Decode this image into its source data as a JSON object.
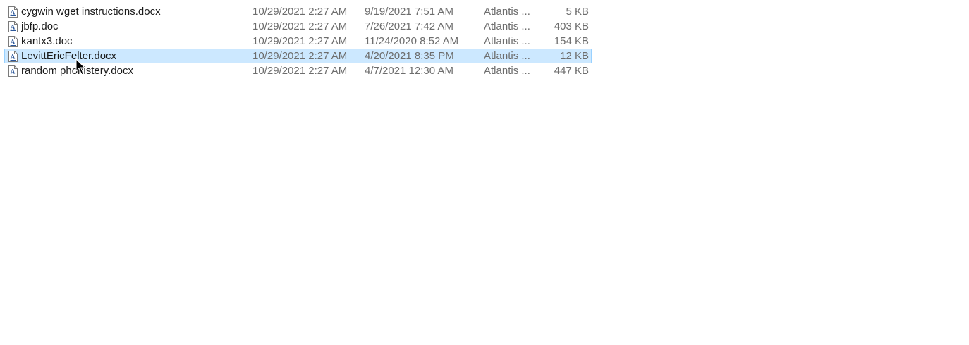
{
  "files": [
    {
      "name": "cygwin wget instructions.docx",
      "created": "10/29/2021 2:27 AM",
      "modified": "9/19/2021 7:51 AM",
      "author": "Atlantis ...",
      "size": "5 KB",
      "icon": "word-document-icon",
      "selected": false
    },
    {
      "name": "jbfp.doc",
      "created": "10/29/2021 2:27 AM",
      "modified": "7/26/2021 7:42 AM",
      "author": "Atlantis ...",
      "size": "403 KB",
      "icon": "word-document-icon",
      "selected": false
    },
    {
      "name": "kantx3.doc",
      "created": "10/29/2021 2:27 AM",
      "modified": "11/24/2020 8:52 AM",
      "author": "Atlantis ...",
      "size": "154 KB",
      "icon": "word-document-icon",
      "selected": false
    },
    {
      "name": "LevittEricFelter.docx",
      "created": "10/29/2021 2:27 AM",
      "modified": "4/20/2021 8:35 PM",
      "author": "Atlantis ...",
      "size": "12 KB",
      "icon": "word-document-icon",
      "selected": true
    },
    {
      "name": "random phonistery.docx",
      "created": "10/29/2021 2:27 AM",
      "modified": "4/7/2021 12:30 AM",
      "author": "Atlantis ...",
      "size": "447 KB",
      "icon": "word-document-icon",
      "selected": false
    }
  ],
  "colors": {
    "selection_bg": "#cce8ff",
    "selection_border": "#99d1ff",
    "secondary_text": "#6d6d6d",
    "icon_accent": "#2b579a"
  },
  "cursor": "mouse-pointer-icon"
}
